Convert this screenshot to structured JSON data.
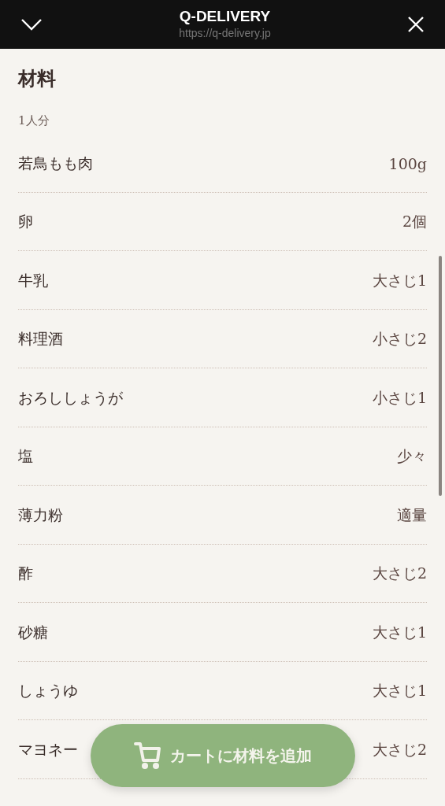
{
  "header": {
    "title": "Q-DELIVERY",
    "url": "https://q-delivery.jp"
  },
  "heading": "材料",
  "servings": "1人分",
  "ingredients": [
    {
      "name": "若鳥もも肉",
      "amount": "100g"
    },
    {
      "name": "卵",
      "amount": "2個"
    },
    {
      "name": "牛乳",
      "amount": "大さじ1"
    },
    {
      "name": "料理酒",
      "amount": "小さじ2"
    },
    {
      "name": "おろししょうが",
      "amount": "小さじ1"
    },
    {
      "name": "塩",
      "amount": "少々"
    },
    {
      "name": "薄力粉",
      "amount": "適量"
    },
    {
      "name": "酢",
      "amount": "大さじ2"
    },
    {
      "name": "砂糖",
      "amount": "大さじ1"
    },
    {
      "name": "しょうゆ",
      "amount": "大さじ1"
    },
    {
      "name": "マヨネー",
      "amount": "大さじ2"
    }
  ],
  "cart_button": {
    "label": "カートに材料を追加"
  }
}
